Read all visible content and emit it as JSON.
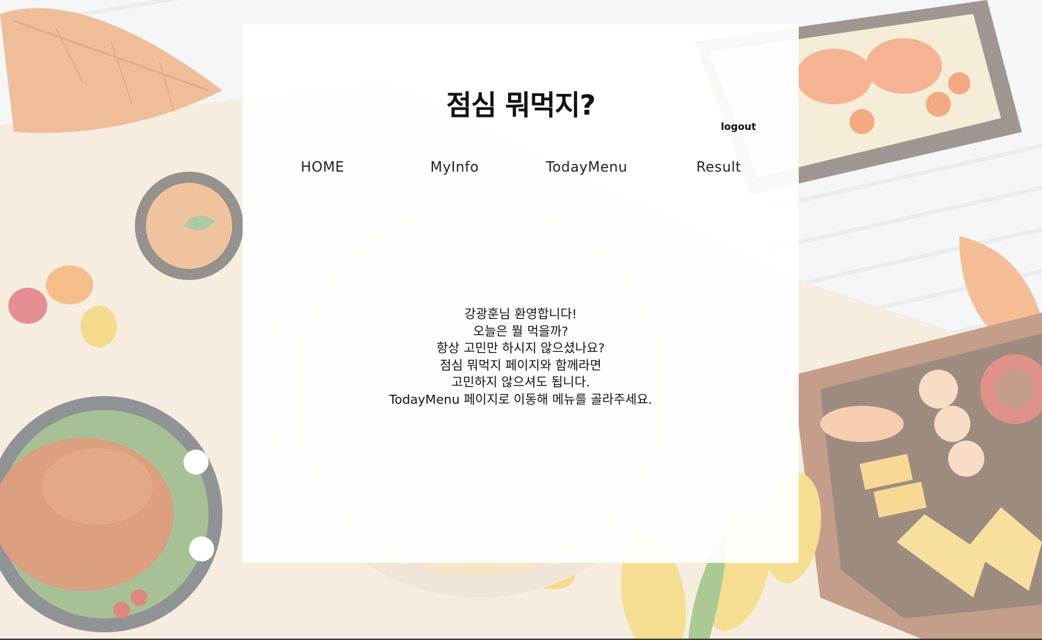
{
  "header": {
    "title": "점심 뭐먹지?",
    "logout_label": "logout"
  },
  "nav": {
    "items": [
      {
        "label": "HOME"
      },
      {
        "label": "MyInfo"
      },
      {
        "label": "TodayMenu"
      },
      {
        "label": "Result"
      }
    ]
  },
  "welcome": {
    "lines": [
      "강광훈님 환영합니다!",
      "오늘은 뭘 먹을까?",
      "항상 고민만 하시지 않으셨나요?",
      "점심 뭐먹지 페이지와 함께라면",
      "고민하지 않으셔도 됩니다.",
      "TodayMenu 페이지로 이동해 메뉴를 골라주세요."
    ]
  },
  "colors": {
    "background_base": "#efe5d6",
    "panel": "#ffffff",
    "text": "#111111",
    "accent_orange": "#e8955a"
  },
  "background": {
    "icon_names": [
      "autumn-leaf-icon",
      "shrimp-tray-icon",
      "roast-chicken-icon",
      "corn-icon",
      "pepper-icon",
      "paella-pan-icon",
      "snack-board-icon",
      "soup-bowl-icon"
    ]
  }
}
